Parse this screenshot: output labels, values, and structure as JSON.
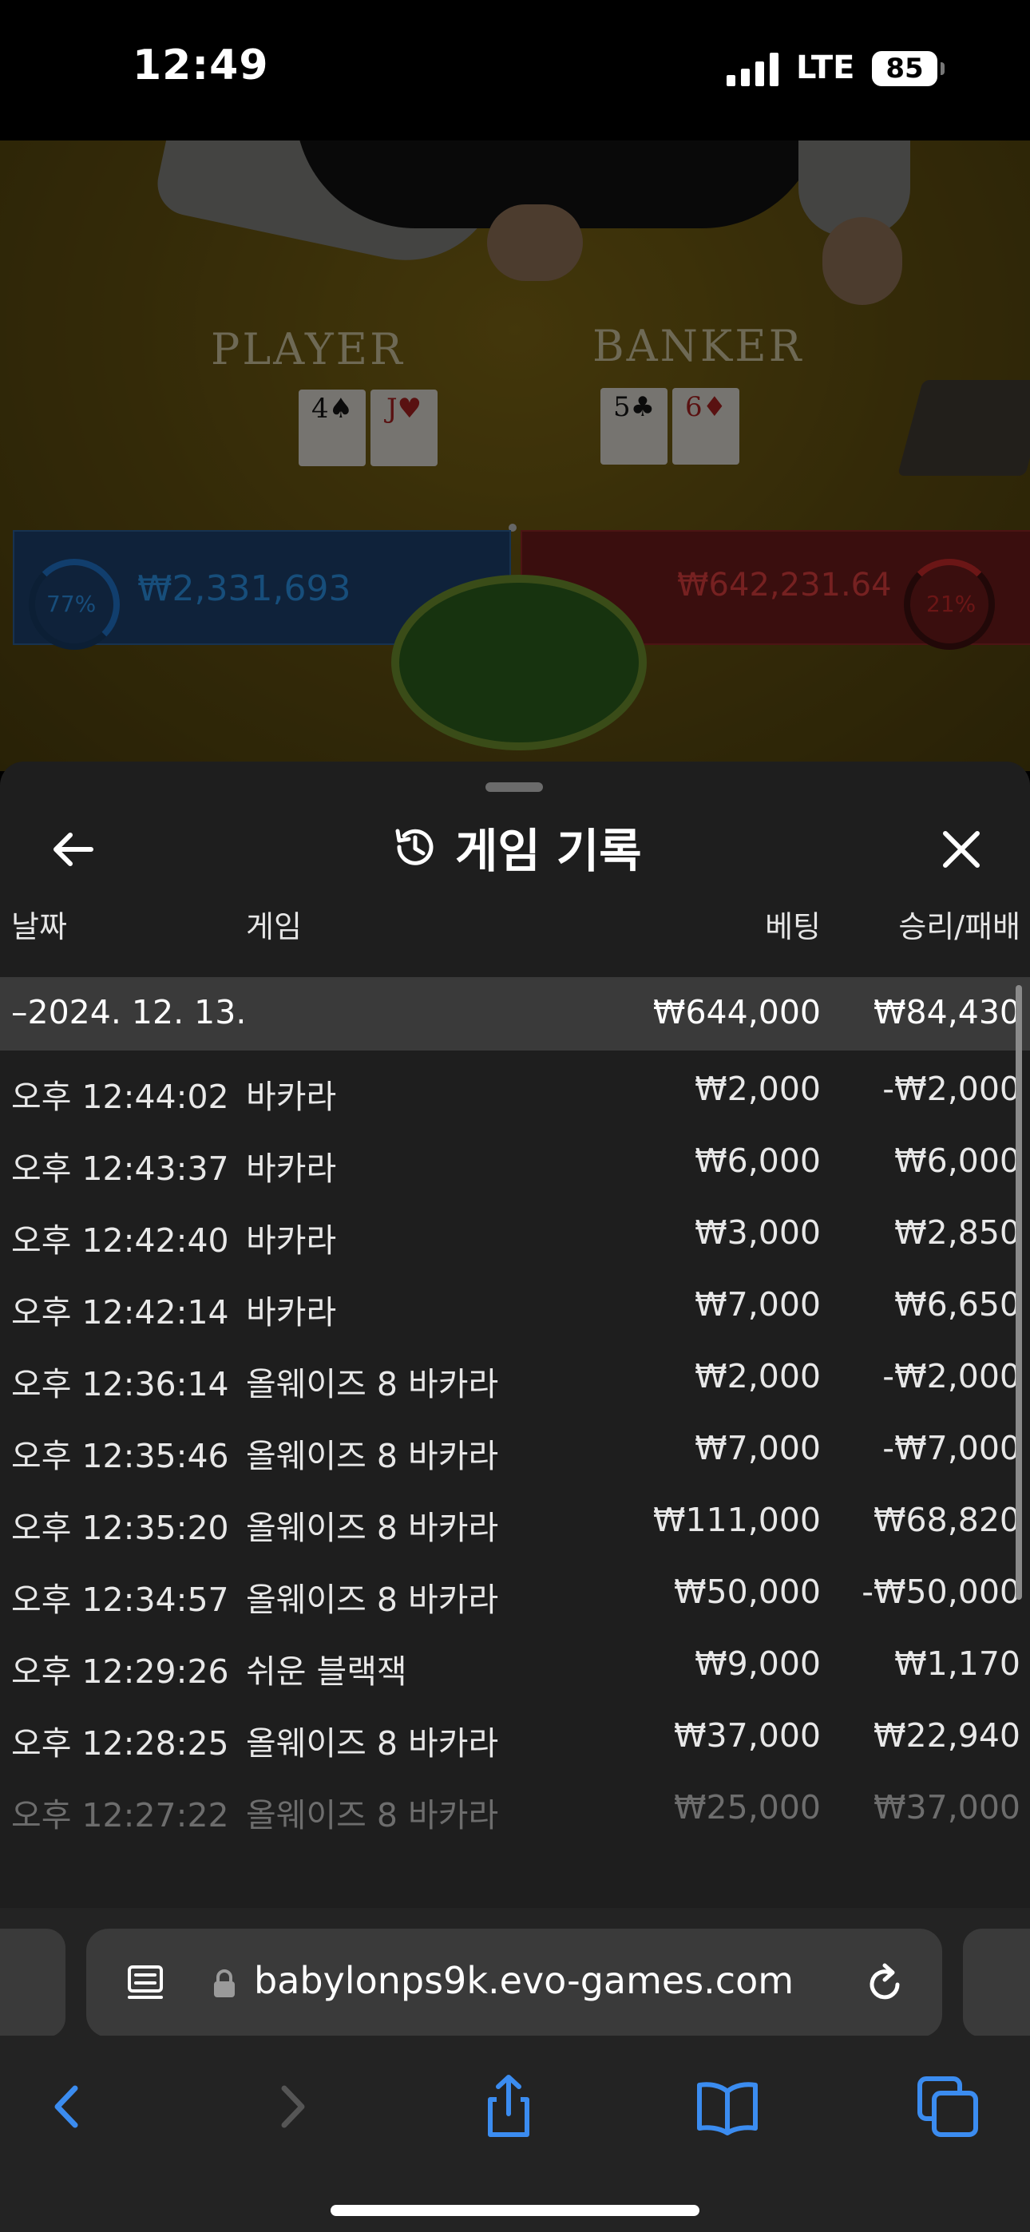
{
  "status_bar": {
    "time": "12:49",
    "network": "LTE",
    "battery": "85"
  },
  "game_view": {
    "player_label": "PLAYER",
    "banker_label": "BANKER",
    "player_cards": [
      {
        "rank": "4",
        "suit": "♠",
        "color": "black"
      },
      {
        "rank": "J",
        "suit": "♥",
        "color": "red"
      }
    ],
    "banker_cards": [
      {
        "rank": "5",
        "suit": "♣",
        "color": "black"
      },
      {
        "rank": "6",
        "suit": "♦",
        "color": "red"
      }
    ],
    "player_bet_total": "₩2,331,693",
    "banker_bet_total": "₩642,231.64",
    "player_percent": "77%",
    "banker_percent": "21%"
  },
  "history_sheet": {
    "title": "게임 기록",
    "columns": {
      "date": "날짜",
      "game": "게임",
      "bet": "베팅",
      "win_loss": "승리/패배"
    },
    "day_summary": {
      "date": "–2024. 12. 13.",
      "bet": "₩644,000",
      "win_loss": "₩84,430"
    },
    "rows": [
      {
        "time": "오후 12:44:02",
        "game": "바카라",
        "bet": "₩2,000",
        "win_loss": "-₩2,000"
      },
      {
        "time": "오후 12:43:37",
        "game": "바카라",
        "bet": "₩6,000",
        "win_loss": "₩6,000"
      },
      {
        "time": "오후 12:42:40",
        "game": "바카라",
        "bet": "₩3,000",
        "win_loss": "₩2,850"
      },
      {
        "time": "오후 12:42:14",
        "game": "바카라",
        "bet": "₩7,000",
        "win_loss": "₩6,650"
      },
      {
        "time": "오후 12:36:14",
        "game": "올웨이즈 8 바카라",
        "bet": "₩2,000",
        "win_loss": "-₩2,000"
      },
      {
        "time": "오후 12:35:46",
        "game": "올웨이즈 8 바카라",
        "bet": "₩7,000",
        "win_loss": "-₩7,000"
      },
      {
        "time": "오후 12:35:20",
        "game": "올웨이즈 8 바카라",
        "bet": "₩111,000",
        "win_loss": "₩68,820"
      },
      {
        "time": "오후 12:34:57",
        "game": "올웨이즈 8 바카라",
        "bet": "₩50,000",
        "win_loss": "-₩50,000"
      },
      {
        "time": "오후 12:29:26",
        "game": "쉬운 블랙잭",
        "bet": "₩9,000",
        "win_loss": "₩1,170"
      },
      {
        "time": "오후 12:28:25",
        "game": "올웨이즈 8 바카라",
        "bet": "₩37,000",
        "win_loss": "₩22,940"
      },
      {
        "time": "오후 12:27:22",
        "game": "올웨이즈 8 바카라",
        "bet": "₩25,000",
        "win_loss": "₩37,000"
      }
    ]
  },
  "browser": {
    "url": "babylonps9k.evo-games.com",
    "icons": [
      "reader-icon",
      "lock-icon",
      "reload-icon",
      "back-icon",
      "forward-icon",
      "share-icon",
      "bookmarks-icon",
      "tabs-icon"
    ]
  },
  "colors": {
    "sheet_bg": "#1e1e1e",
    "day_row_bg": "#3a3a3a",
    "accent_blue": "#3b8cf0",
    "player_blue": "#2a8fe0",
    "banker_red": "#d83c3c"
  }
}
